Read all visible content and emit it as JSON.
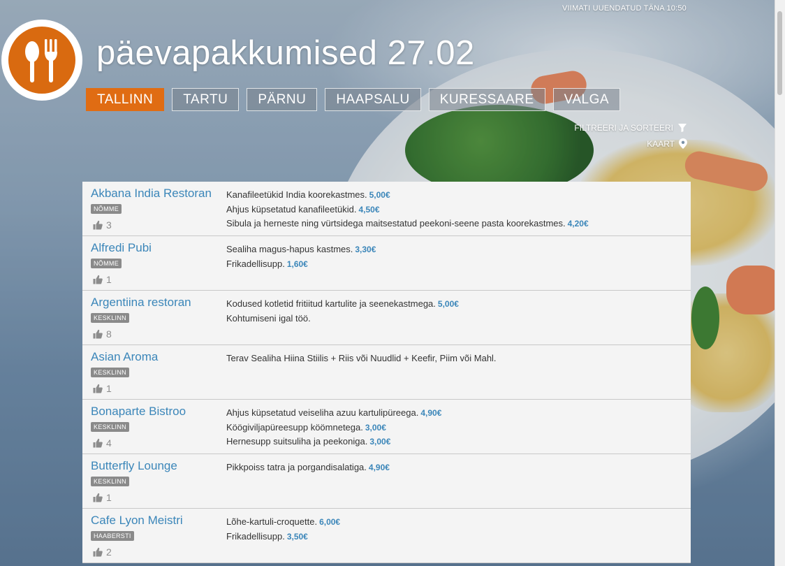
{
  "header": {
    "updated": "VIIMATI UUENDATUD TÄNA 10:50",
    "title": "päevapakkumised 27.02",
    "logo_icon": "spoon-fork-icon",
    "accent_color": "#e06c13"
  },
  "cities": [
    {
      "label": "TALLINN",
      "active": true
    },
    {
      "label": "TARTU"
    },
    {
      "label": "PÄRNU"
    },
    {
      "label": "HAAPSALU"
    },
    {
      "label": "KURESSAARE"
    },
    {
      "label": "VALGA"
    }
  ],
  "tools": {
    "filter_label": "FILTREERI JA SORTEERI",
    "filter_icon": "funnel-icon",
    "map_label": "KAART",
    "map_icon": "map-pin-icon"
  },
  "restaurants": [
    {
      "name": "Akbana India Restoran",
      "district": "NÕMME",
      "likes": "3",
      "dishes": [
        {
          "text": "Kanafileetükid India koorekastmes.",
          "price": "5,00€"
        },
        {
          "text": "Ahjus küpsetatud kanafileetükid.",
          "price": "4,50€"
        },
        {
          "text": "Sibula ja herneste ning vürtsidega maitsestatud peekoni-seene pasta koorekastmes.",
          "price": "4,20€"
        }
      ]
    },
    {
      "name": "Alfredi Pubi",
      "district": "NÕMME",
      "likes": "1",
      "dishes": [
        {
          "text": "Sealiha magus-hapus kastmes.",
          "price": "3,30€"
        },
        {
          "text": "Frikadellisupp.",
          "price": "1,60€"
        }
      ]
    },
    {
      "name": "Argentiina restoran",
      "district": "KESKLINN",
      "likes": "8",
      "dishes": [
        {
          "text": "Kodused kotletid fritiitud kartulite ja seenekastmega.",
          "price": "5,00€"
        },
        {
          "text": "Kohtumiseni igal töö.",
          "price": ""
        }
      ]
    },
    {
      "name": "Asian Aroma",
      "district": "KESKLINN",
      "likes": "1",
      "dishes": [
        {
          "text": "Terav Sealiha Hiina Stiilis + Riis või Nuudlid + Keefir, Piim või Mahl.",
          "price": ""
        }
      ]
    },
    {
      "name": "Bonaparte Bistroo",
      "district": "KESKLINN",
      "likes": "4",
      "dishes": [
        {
          "text": "Ahjus küpsetatud veiseliha azuu kartulipüreega.",
          "price": "4,90€"
        },
        {
          "text": "Köögiviljapüreesupp köömnetega.",
          "price": "3,00€"
        },
        {
          "text": "Hernesupp suitsuliha ja peekoniga.",
          "price": "3,00€"
        }
      ]
    },
    {
      "name": "Butterfly Lounge",
      "district": "KESKLINN",
      "likes": "1",
      "dishes": [
        {
          "text": "Pikkpoiss tatra ja porgandisalatiga.",
          "price": "4,90€"
        }
      ]
    },
    {
      "name": "Cafe Lyon Meistri",
      "district": "HAABERSTI",
      "likes": "2",
      "dishes": [
        {
          "text": "Lõhe-kartuli-croquette.",
          "price": "6,00€"
        },
        {
          "text": "Frikadellisupp.",
          "price": "3,50€"
        }
      ]
    }
  ]
}
